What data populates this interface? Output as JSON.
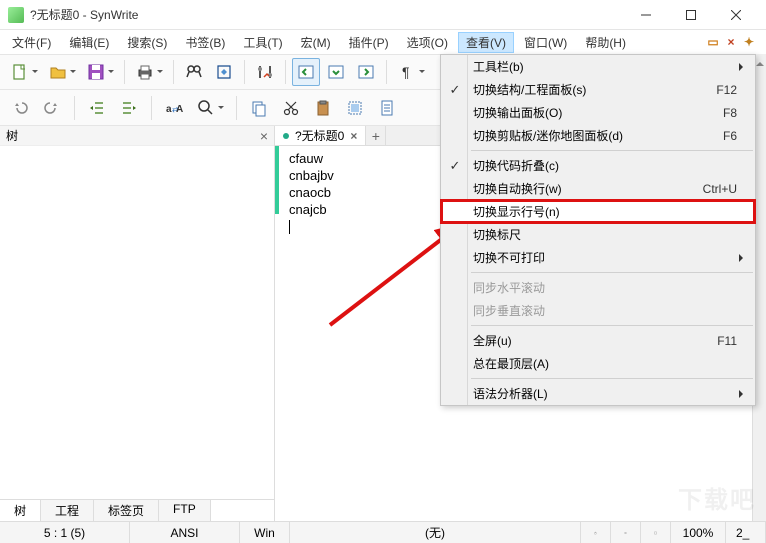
{
  "window": {
    "title": "?无标题0 - SynWrite"
  },
  "menubar": {
    "items": [
      {
        "label": "文件(F)"
      },
      {
        "label": "编辑(E)"
      },
      {
        "label": "搜索(S)"
      },
      {
        "label": "书签(B)"
      },
      {
        "label": "工具(T)"
      },
      {
        "label": "宏(M)"
      },
      {
        "label": "插件(P)"
      },
      {
        "label": "选项(O)"
      },
      {
        "label": "查看(V)",
        "active": true
      },
      {
        "label": "窗口(W)"
      },
      {
        "label": "帮助(H)"
      }
    ]
  },
  "sidebar": {
    "title": "树",
    "tabs": [
      {
        "label": "树",
        "active": true
      },
      {
        "label": "工程"
      },
      {
        "label": "标签页"
      },
      {
        "label": "FTP"
      }
    ]
  },
  "editor": {
    "tab_title": "?无标题0",
    "lines": [
      "cfauw",
      "cnbajbv",
      "cnaocb",
      "cnajcb"
    ]
  },
  "view_menu": {
    "items": [
      {
        "label": "工具栏(b)",
        "arrow": true
      },
      {
        "label": "切换结构/工程面板(s)",
        "shortcut": "F12",
        "checked": true
      },
      {
        "label": "切换输出面板(O)",
        "shortcut": "F8"
      },
      {
        "label": "切换剪贴板/迷你地图面板(d)",
        "shortcut": "F6"
      },
      {
        "sep": true
      },
      {
        "label": "切换代码折叠(c)",
        "checked": true
      },
      {
        "label": "切换自动换行(w)",
        "shortcut": "Ctrl+U"
      },
      {
        "label": "切换显示行号(n)",
        "highlighted": true
      },
      {
        "label": "切换标尺"
      },
      {
        "label": "切换不可打印",
        "arrow": true
      },
      {
        "sep": true
      },
      {
        "label": "同步水平滚动",
        "disabled": true
      },
      {
        "label": "同步垂直滚动",
        "disabled": true
      },
      {
        "sep": true
      },
      {
        "label": "全屏(u)",
        "shortcut": "F11"
      },
      {
        "label": "总在最顶层(A)"
      },
      {
        "sep": true
      },
      {
        "label": "语法分析器(L)",
        "arrow": true
      }
    ]
  },
  "statusbar": {
    "pos": "5 : 1 (5)",
    "encoding": "ANSI",
    "eol": "Win",
    "lexer": "(无)",
    "zoom": "100%",
    "extra": "2_"
  },
  "watermark": "下载吧"
}
